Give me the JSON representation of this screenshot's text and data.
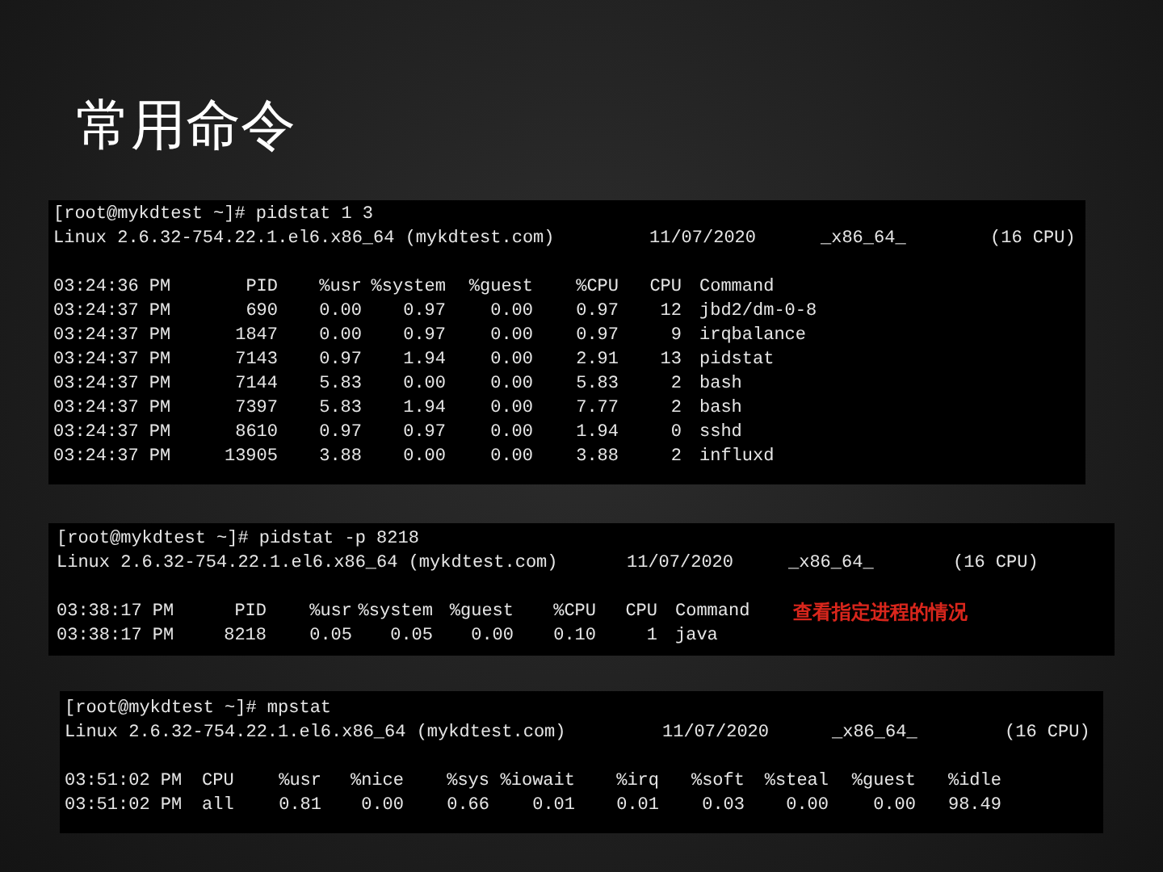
{
  "title": "常用命令",
  "terminals": [
    {
      "prompt": "[root@mykdtest ~]# pidstat 1 3",
      "system_info": [
        "Linux 2.6.32-754.22.1.el6.x86_64 (mykdtest.com)",
        "11/07/2020",
        "_x86_64_",
        "(16 CPU)"
      ],
      "columns": [
        "03:24:36 PM",
        "PID",
        "%usr",
        "%system",
        "%guest",
        "%CPU",
        "CPU",
        "Command"
      ],
      "rows": [
        [
          "03:24:37 PM",
          "690",
          "0.00",
          "0.97",
          "0.00",
          "0.97",
          "12",
          "jbd2/dm-0-8"
        ],
        [
          "03:24:37 PM",
          "1847",
          "0.00",
          "0.97",
          "0.00",
          "0.97",
          "9",
          "irqbalance"
        ],
        [
          "03:24:37 PM",
          "7143",
          "0.97",
          "1.94",
          "0.00",
          "2.91",
          "13",
          "pidstat"
        ],
        [
          "03:24:37 PM",
          "7144",
          "5.83",
          "0.00",
          "0.00",
          "5.83",
          "2",
          "bash"
        ],
        [
          "03:24:37 PM",
          "7397",
          "5.83",
          "1.94",
          "0.00",
          "7.77",
          "2",
          "bash"
        ],
        [
          "03:24:37 PM",
          "8610",
          "0.97",
          "0.97",
          "0.00",
          "1.94",
          "0",
          "sshd"
        ],
        [
          "03:24:37 PM",
          "13905",
          "3.88",
          "0.00",
          "0.00",
          "3.88",
          "2",
          "influxd"
        ]
      ]
    },
    {
      "prompt": "[root@mykdtest ~]# pidstat -p 8218",
      "system_info": [
        "Linux 2.6.32-754.22.1.el6.x86_64 (mykdtest.com)",
        "11/07/2020",
        "_x86_64_",
        "(16 CPU)"
      ],
      "columns": [
        "03:38:17 PM",
        "PID",
        "%usr",
        "%system",
        "%guest",
        "%CPU",
        "CPU",
        "Command"
      ],
      "note": "查看指定进程的情况",
      "rows": [
        [
          "03:38:17 PM",
          "8218",
          "0.05",
          "0.05",
          "0.00",
          "0.10",
          "1",
          "java"
        ]
      ]
    },
    {
      "prompt": "[root@mykdtest ~]# mpstat",
      "system_info": [
        "Linux 2.6.32-754.22.1.el6.x86_64 (mykdtest.com)",
        "11/07/2020",
        "_x86_64_",
        "(16 CPU)"
      ],
      "columns": [
        "03:51:02 PM",
        "CPU",
        "%usr",
        "%nice",
        "%sys",
        "%iowait",
        "%irq",
        "%soft",
        "%steal",
        "%guest",
        "%idle"
      ],
      "rows": [
        [
          "03:51:02 PM",
          "all",
          "0.81",
          "0.00",
          "0.66",
          "0.01",
          "0.01",
          "0.03",
          "0.00",
          "0.00",
          "98.49"
        ]
      ]
    }
  ]
}
